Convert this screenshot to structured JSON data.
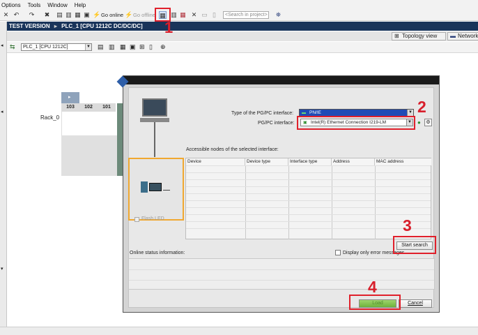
{
  "menu": {
    "items": [
      "Options",
      "Tools",
      "Window",
      "Help"
    ]
  },
  "toolbar": {
    "go_online": "Go online",
    "go_offline": "Go offline",
    "search_placeholder": "<Search in project>"
  },
  "titlebar": {
    "version": "TEST VERSION",
    "breadcrumb": "PLC_1 [CPU 1212C DC/DC/DC]"
  },
  "view_tabs": {
    "topology": "Topology view",
    "network": "Network"
  },
  "device_toolbar": {
    "selected_device": "PLC_1 [CPU 1212C]"
  },
  "rack": {
    "label": "Rack_0",
    "slots": [
      "103",
      "102",
      "101"
    ]
  },
  "dialog": {
    "pgpc_type_label": "Type of the PG/PC interface:",
    "pgpc_type_value": "PN/IE",
    "pgpc_interface_label": "PG/PC interface:",
    "pgpc_interface_value": "Intel(R) Ethernet Connection I219-LM",
    "accessible_nodes_label": "Accessible nodes of the selected interface:",
    "table_columns": [
      "Device",
      "Device type",
      "Interface type",
      "Address",
      "MAC address"
    ],
    "flash_led_label": "Flash LED",
    "start_search_label": "Start search",
    "online_status_label": "Online status information:",
    "display_errors_label": "Display only error messages",
    "load_label": "Load",
    "cancel_label": "Cancel"
  },
  "annotations": [
    "1",
    "2",
    "3",
    "4"
  ],
  "colors": {
    "titlebar": "#19345a",
    "highlight": "#e0202b",
    "node_panel_border": "#f0a830",
    "load_button": "#7fc24a"
  }
}
